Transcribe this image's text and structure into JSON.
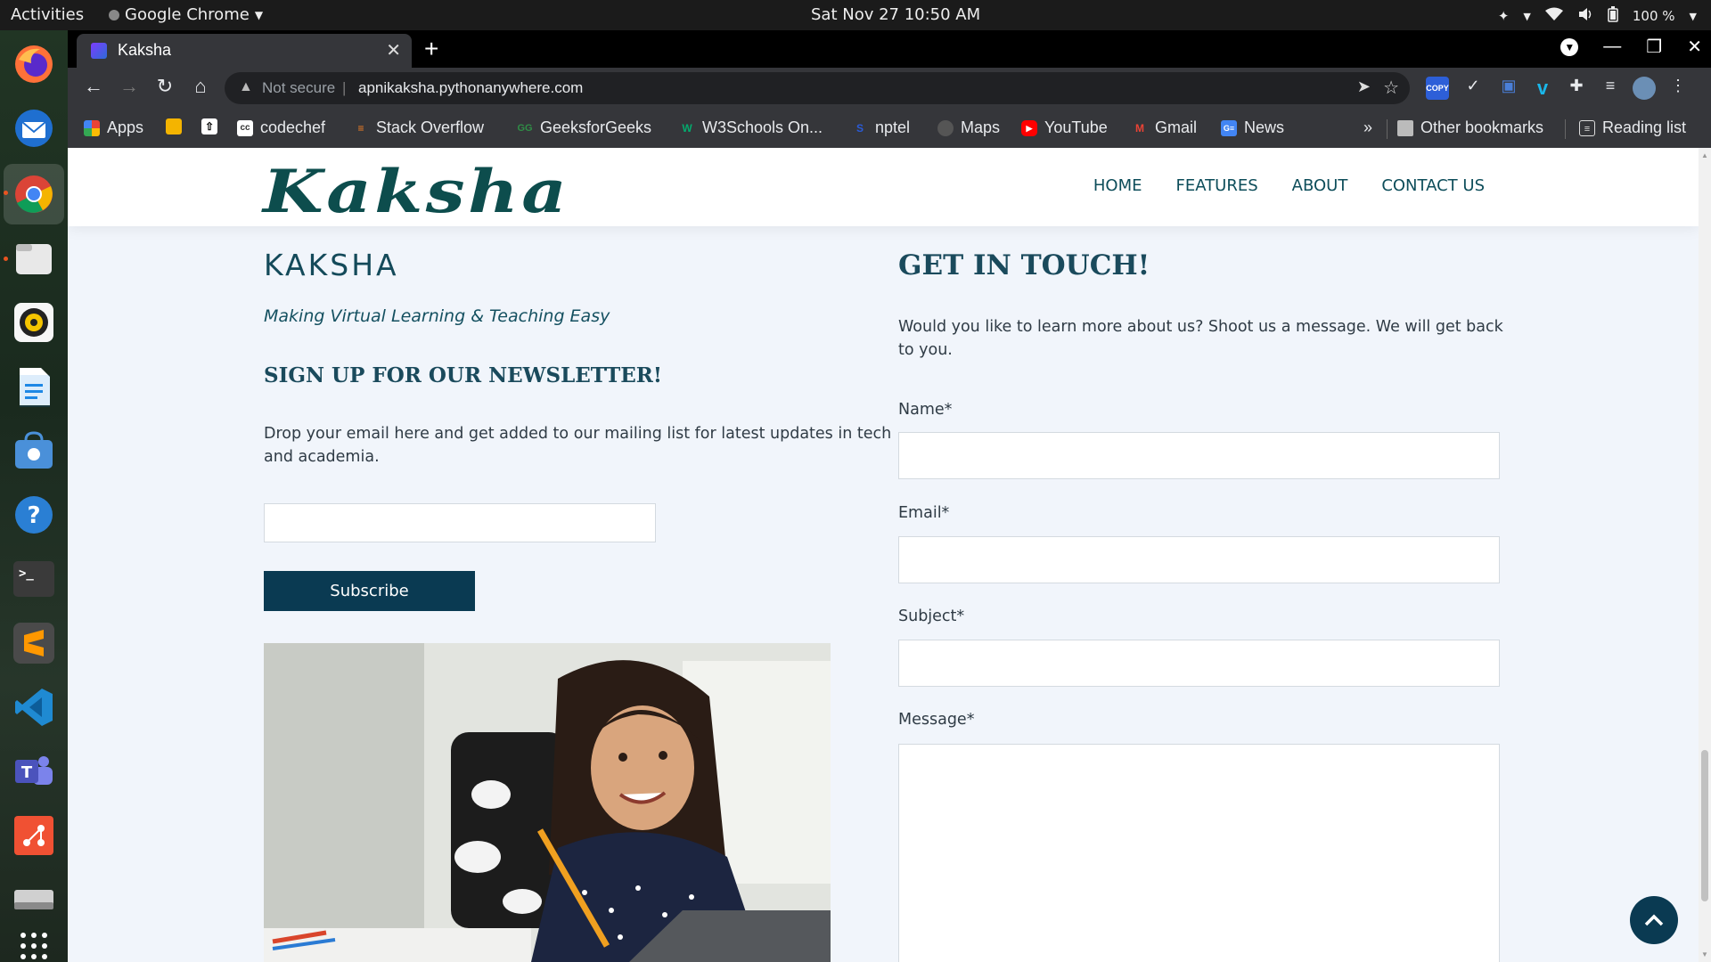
{
  "system": {
    "activities": "Activities",
    "app_name": "Google Chrome",
    "clock": "Sat Nov 27  10:50 AM",
    "battery": "100 %"
  },
  "browser": {
    "tab_title": "Kaksha",
    "not_secure": "Not secure",
    "url": "apnikaksha.pythonanywhere.com",
    "copy_ext_label": "COPY",
    "bookmarks": [
      {
        "label": "Apps"
      },
      {
        "label": "codechef"
      },
      {
        "label": "Stack Overflow"
      },
      {
        "label": "GeeksforGeeks"
      },
      {
        "label": "W3Schools On..."
      },
      {
        "label": "nptel"
      },
      {
        "label": "Maps"
      },
      {
        "label": "YouTube"
      },
      {
        "label": "Gmail"
      },
      {
        "label": "News"
      }
    ],
    "overflow": "»",
    "other_bookmarks": "Other bookmarks",
    "reading_list": "Reading list"
  },
  "site": {
    "logo": "Kaksha",
    "nav": [
      "HOME",
      "FEATURES",
      "ABOUT",
      "CONTACT US"
    ],
    "brand_heading": "KAKSHA",
    "tagline": "Making Virtual Learning & Teaching Easy",
    "newsletter_heading": "SIGN UP FOR OUR NEWSLETTER!",
    "newsletter_text": "Drop your email here and get added to our mailing list for latest updates in tech and academia.",
    "subscribe_label": "Subscribe",
    "contact_heading": "GET IN TOUCH!",
    "contact_text": "Would you like to learn more about us? Shoot us a message. We will get back to you.",
    "fields": {
      "name": "Name*",
      "email": "Email*",
      "subject": "Subject*",
      "message": "Message*"
    }
  },
  "colors": {
    "brand": "#0d4d4d",
    "button": "#0a3a52",
    "page_bg": "#f1f5fb"
  }
}
